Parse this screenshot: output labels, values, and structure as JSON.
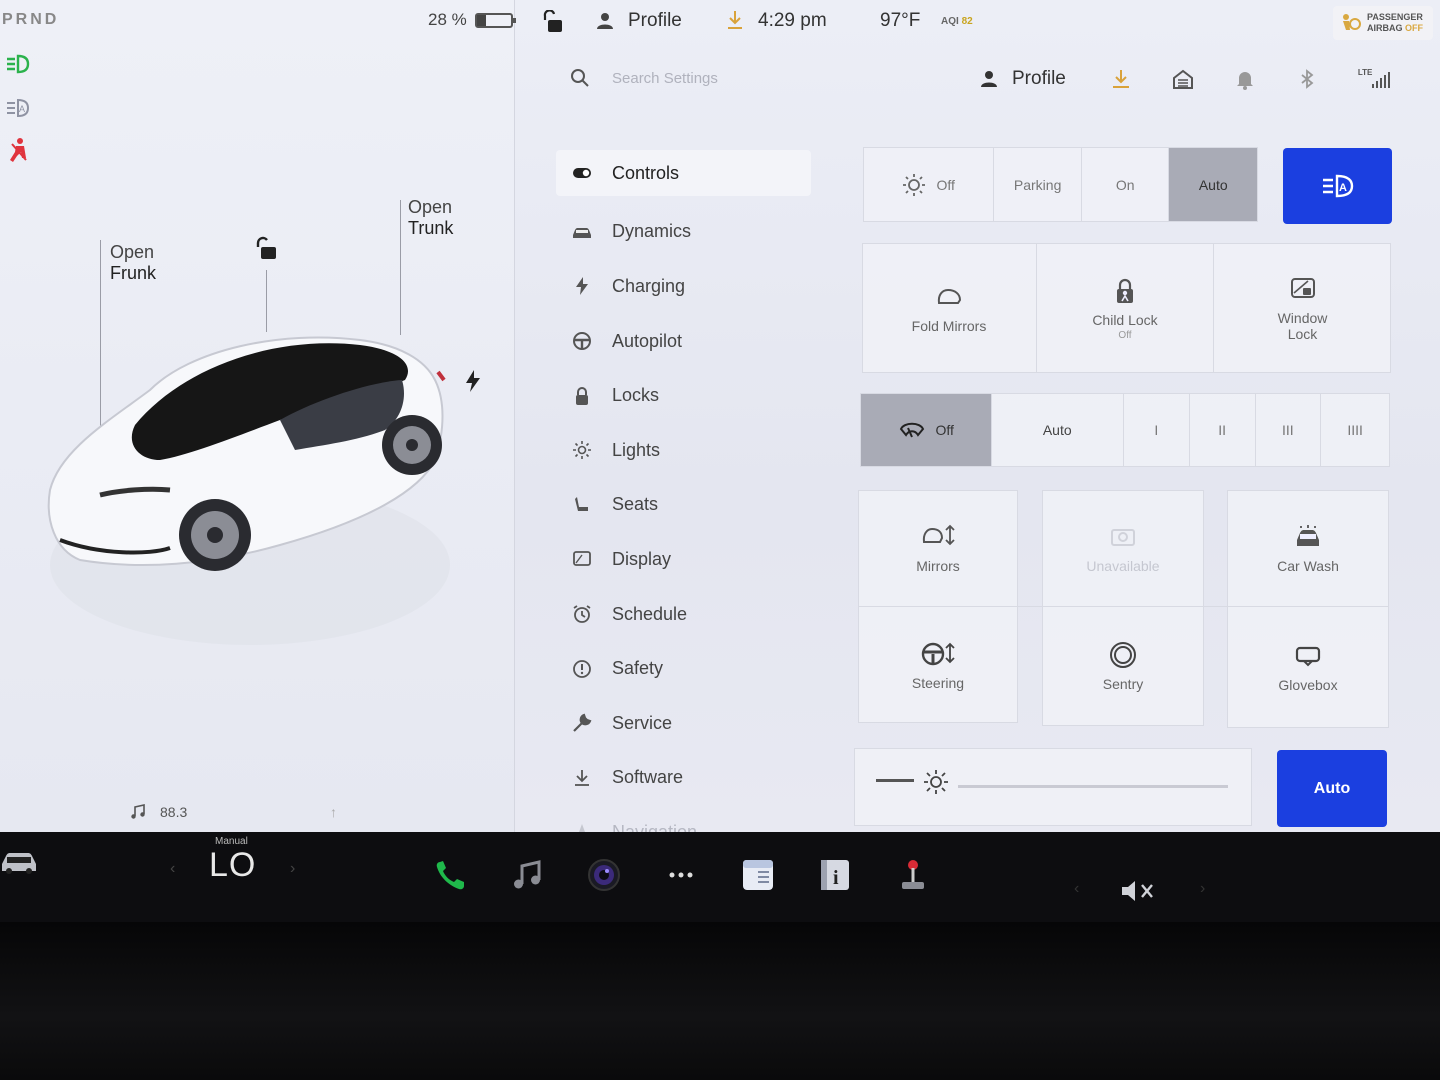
{
  "status_bar": {
    "gear": "PRND",
    "battery_percent": "28 %",
    "battery_level": 0.28,
    "profile_label": "Profile",
    "time": "4:29 pm",
    "temperature": "97°F",
    "aqi_label": "AQI",
    "aqi_value": "82",
    "airbag_line1": "PASSENGER",
    "airbag_line2": "AIRBAG",
    "airbag_state": "OFF"
  },
  "car": {
    "frunk_line1": "Open",
    "frunk_line2": "Frunk",
    "trunk_line1": "Open",
    "trunk_line2": "Trunk"
  },
  "media": {
    "station": "88.3"
  },
  "settings_header": {
    "search_placeholder": "Search Settings",
    "profile_label": "Profile",
    "network": "LTE"
  },
  "nav": {
    "items": [
      {
        "label": "Controls",
        "icon": "toggle-icon"
      },
      {
        "label": "Dynamics",
        "icon": "car-icon"
      },
      {
        "label": "Charging",
        "icon": "bolt-icon"
      },
      {
        "label": "Autopilot",
        "icon": "steering-wheel-icon"
      },
      {
        "label": "Locks",
        "icon": "lock-icon"
      },
      {
        "label": "Lights",
        "icon": "sun-icon"
      },
      {
        "label": "Seats",
        "icon": "seat-icon"
      },
      {
        "label": "Display",
        "icon": "display-icon"
      },
      {
        "label": "Schedule",
        "icon": "alarm-clock-icon"
      },
      {
        "label": "Safety",
        "icon": "alert-circle-icon"
      },
      {
        "label": "Service",
        "icon": "wrench-icon"
      },
      {
        "label": "Software",
        "icon": "download-icon"
      },
      {
        "label": "Navigation",
        "icon": "navigation-icon"
      }
    ]
  },
  "controls": {
    "headlights": {
      "off": "Off",
      "parking": "Parking",
      "on": "On",
      "auto": "Auto",
      "selected": "Auto"
    },
    "fold_mirrors": "Fold Mirrors",
    "child_lock": "Child Lock",
    "child_lock_state": "Off",
    "window_lock_line1": "Window",
    "window_lock_line2": "Lock",
    "wipers": {
      "off": "Off",
      "auto": "Auto",
      "s1": "I",
      "s2": "II",
      "s3": "III",
      "s4": "IIII",
      "selected": "Off"
    },
    "mirrors": "Mirrors",
    "unavailable": "Unavailable",
    "car_wash": "Car Wash",
    "steering": "Steering",
    "sentry": "Sentry",
    "glovebox": "Glovebox",
    "brightness_auto": "Auto",
    "accent_color": "#1b3fe0"
  },
  "bottom_bar": {
    "climate_mode": "Manual",
    "climate_temp": "LO"
  }
}
